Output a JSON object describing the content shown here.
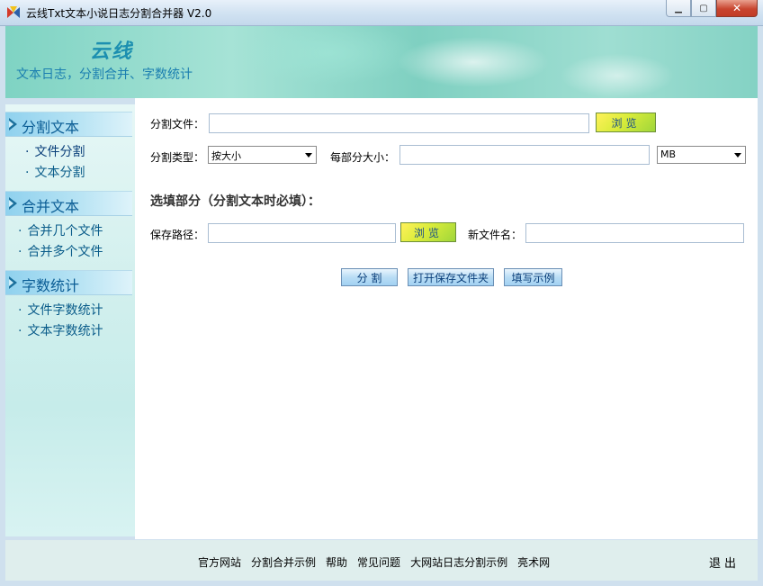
{
  "window": {
    "title": "云线Txt文本小说日志分割合并器 V2.0"
  },
  "banner": {
    "logo": "云线",
    "subtitle": "文本日志，分割合并、字数统计"
  },
  "sidebar": {
    "sections": [
      {
        "label": "分割文本",
        "items": [
          "文件分割",
          "文本分割"
        ]
      },
      {
        "label": "合并文本",
        "items": [
          "合并几个文件",
          "合并多个文件"
        ]
      },
      {
        "label": "字数统计",
        "items": [
          "文件字数统计",
          "文本字数统计"
        ]
      }
    ],
    "bullet": "·"
  },
  "form": {
    "split_file_label": "分割文件：",
    "split_file_value": "",
    "browse_label": "浏览",
    "split_type_label": "分割类型：",
    "split_type_value": "按大小",
    "part_size_label": "每部分大小：",
    "part_size_value": "",
    "unit_value": "MB",
    "optional_title": "选填部分（分割文本时必填）：",
    "save_path_label": "保存路径：",
    "save_path_value": "",
    "browse2_label": "浏览",
    "new_name_label": "新文件名：",
    "new_name_value": "",
    "split_button": "分 割",
    "open_folder_button": "打开保存文件夹",
    "example_button": "填写示例"
  },
  "footer": {
    "links": [
      "官方网站",
      "分割合并示例",
      "帮助",
      "常见问题",
      "大网站日志分割示例",
      "亮术网"
    ],
    "exit": "退出"
  },
  "icons": {
    "app": "app-logo-icon",
    "minimize": "minimize-icon",
    "maximize": "maximize-icon",
    "close": "close-icon",
    "section": "triangle-arrow-icon"
  },
  "colors": {
    "banner": "#9fded2",
    "sidebar_head": "#8fd1ee",
    "browse_button": "#d9ec3a",
    "action_button": "#b9ddf5"
  }
}
